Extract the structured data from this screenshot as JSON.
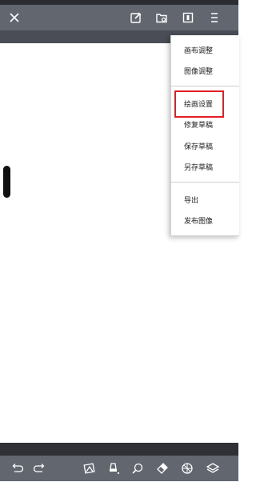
{
  "toolbar": {
    "close_icon": "close-icon",
    "icons": [
      "edit-canvas-icon",
      "open-folder-icon",
      "layers-icon",
      "more-menu-icon"
    ]
  },
  "menu": {
    "items": [
      {
        "label": "画布调整"
      },
      {
        "label": "图像调整"
      },
      {
        "label": "绘画设置"
      },
      {
        "label": "修复草稿"
      },
      {
        "label": "保存草稿"
      },
      {
        "label": "另存草稿"
      },
      {
        "label": "导出"
      },
      {
        "label": "发布图像"
      }
    ],
    "highlighted_item": "绘画设置",
    "highlight_color": "#e51c23"
  },
  "bottombar": {
    "icons": [
      "undo-icon",
      "redo-icon",
      "transform-icon",
      "brush-icon",
      "color-picker-icon",
      "eraser-icon",
      "palette-icon",
      "layer-stack-icon"
    ]
  },
  "colors": {
    "toolbar_bg": "#62666f",
    "accent_red": "#e51c23"
  }
}
